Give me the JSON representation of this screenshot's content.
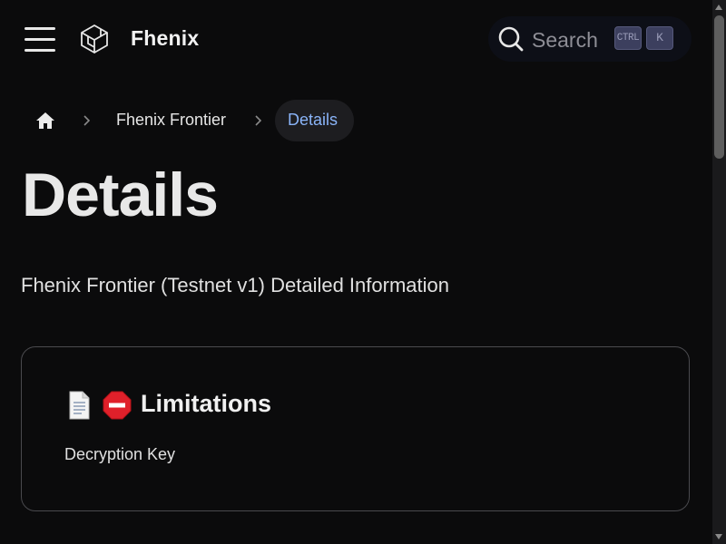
{
  "navbar": {
    "brand": "Fhenix",
    "search": {
      "placeholder": "Search",
      "shortcut_modifier": "CTRL",
      "shortcut_key": "K"
    }
  },
  "breadcrumb": {
    "items": [
      {
        "label": "Fhenix Frontier"
      },
      {
        "label": "Details"
      }
    ]
  },
  "page": {
    "title": "Details",
    "subtitle": "Fhenix Frontier (Testnet v1) Detailed Information"
  },
  "cards": [
    {
      "title": "Limitations",
      "description": "Decryption Key"
    }
  ],
  "colors": {
    "background": "#0b0b0c",
    "accent": "#8ab4f8",
    "card_border": "#4a4a4e"
  }
}
